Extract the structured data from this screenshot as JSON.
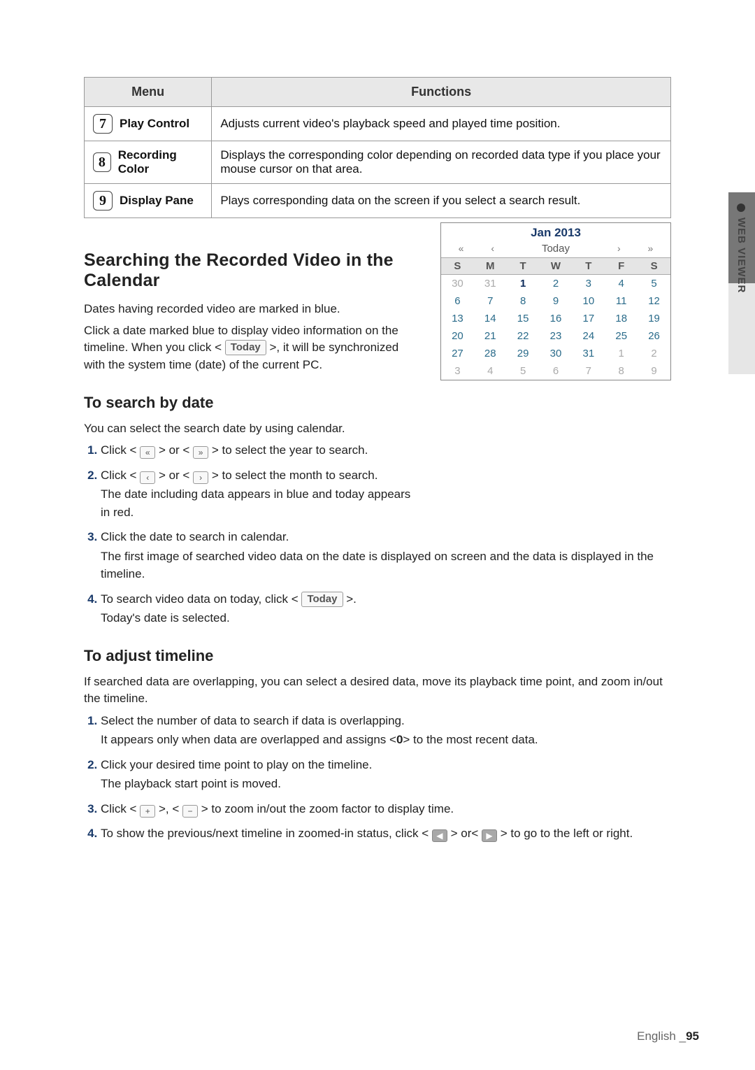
{
  "sideTab": {
    "label": "WEB VIEWER"
  },
  "table": {
    "headers": {
      "menu": "Menu",
      "functions": "Functions"
    },
    "rows": [
      {
        "num": "7",
        "name": "Play Control",
        "desc": "Adjusts current video's playback speed and played time position."
      },
      {
        "num": "8",
        "name": "Recording Color",
        "desc": "Displays the corresponding color depending on recorded data type if you place your mouse cursor on that area."
      },
      {
        "num": "9",
        "name": "Display Pane",
        "desc": "Plays corresponding data on the screen if you select a search result."
      }
    ]
  },
  "section1": {
    "title": "Searching the Recorded Video in the Calendar",
    "p1a": "Dates having recorded video are marked in blue.",
    "p1b_before": "Click a date marked blue to display video information on the timeline. When you click < ",
    "today_btn": "Today",
    "p1b_after": " >, it will be synchronized with the system time (date) of the current PC."
  },
  "section2": {
    "title": "To search by date",
    "intro": "You can select the search date by using calendar.",
    "steps": {
      "s1_a": "Click < ",
      "s1_b": " > or < ",
      "s1_c": " > to select the year to search.",
      "s2_a": "Click < ",
      "s2_b": " > or < ",
      "s2_c": " > to select the month to search.",
      "s2_sub": "The date including data appears in blue and today appears in red.",
      "s3_a": "Click the date to search in calendar.",
      "s3_sub": "The first image of searched video data on the date is displayed on screen and the data is displayed in the timeline.",
      "s4_a": "To search video data on today, click < ",
      "today_btn": "Today",
      "s4_b": " >.",
      "s4_sub": "Today's date is selected."
    }
  },
  "section3": {
    "title": "To adjust timeline",
    "intro": "If searched data are overlapping, you can select a desired data, move its playback time point, and zoom in/out the timeline.",
    "steps": {
      "s1_a": "Select the number of data to search if data is overlapping.",
      "s1_sub_a": "It appears only when data are overlapped and assigns <",
      "s1_sub_b": "0",
      "s1_sub_c": "> to the most recent data.",
      "s2_a": "Click your desired time point to play on the timeline.",
      "s2_sub": "The playback start point is moved.",
      "s3_a": "Click < ",
      "s3_b": " >, < ",
      "s3_c": " > to zoom in/out the zoom factor to display time.",
      "s4_a": "To show the previous/next timeline in zoomed-in status, click < ",
      "s4_b": " > or< ",
      "s4_c": " > to go to the left or right."
    }
  },
  "calendar": {
    "title": "Jan 2013",
    "nav": {
      "first": "«",
      "prev": "‹",
      "today": "Today",
      "next": "›",
      "last": "»"
    },
    "dow": [
      "S",
      "M",
      "T",
      "W",
      "T",
      "F",
      "S"
    ],
    "cells": [
      {
        "d": "30",
        "o": true
      },
      {
        "d": "31",
        "o": true
      },
      {
        "d": "1",
        "b": true
      },
      {
        "d": "2"
      },
      {
        "d": "3"
      },
      {
        "d": "4"
      },
      {
        "d": "5"
      },
      {
        "d": "6"
      },
      {
        "d": "7"
      },
      {
        "d": "8"
      },
      {
        "d": "9"
      },
      {
        "d": "10"
      },
      {
        "d": "11"
      },
      {
        "d": "12"
      },
      {
        "d": "13"
      },
      {
        "d": "14"
      },
      {
        "d": "15"
      },
      {
        "d": "16"
      },
      {
        "d": "17"
      },
      {
        "d": "18"
      },
      {
        "d": "19"
      },
      {
        "d": "20"
      },
      {
        "d": "21"
      },
      {
        "d": "22"
      },
      {
        "d": "23"
      },
      {
        "d": "24"
      },
      {
        "d": "25"
      },
      {
        "d": "26"
      },
      {
        "d": "27"
      },
      {
        "d": "28"
      },
      {
        "d": "29"
      },
      {
        "d": "30"
      },
      {
        "d": "31"
      },
      {
        "d": "1",
        "o": true
      },
      {
        "d": "2",
        "o": true
      },
      {
        "d": "3",
        "o": true
      },
      {
        "d": "4",
        "o": true
      },
      {
        "d": "5",
        "o": true
      },
      {
        "d": "6",
        "o": true
      },
      {
        "d": "7",
        "o": true
      },
      {
        "d": "8",
        "o": true
      },
      {
        "d": "9",
        "o": true
      }
    ]
  },
  "icons": {
    "dbl_left": "«",
    "dbl_right": "»",
    "left": "‹",
    "right": "›",
    "plus": "+",
    "minus": "−",
    "tri_left": "◀",
    "tri_right": "▶"
  },
  "footer": {
    "lang": "English",
    "sep": "_",
    "page": "95"
  }
}
